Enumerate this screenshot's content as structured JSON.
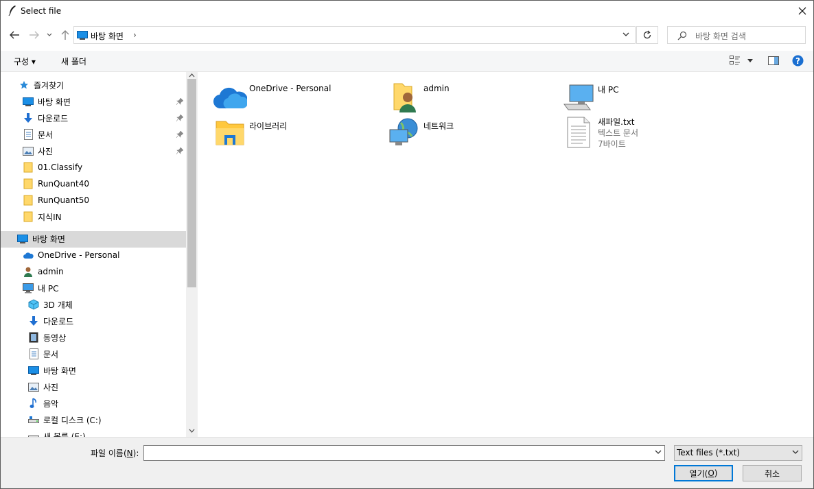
{
  "window": {
    "title": "Select file"
  },
  "address": {
    "path": "바탕 화면",
    "separator": "›"
  },
  "search": {
    "placeholder": "바탕 화면 검색"
  },
  "commandbar": {
    "organize": "구성 ▾",
    "new_folder": "새 폴더"
  },
  "nav": {
    "quick_access": "즐겨찾기",
    "qa_items": [
      "바탕 화면",
      "다운로드",
      "문서",
      "사진",
      "01.Classify",
      "RunQuant40",
      "RunQuant50",
      "지식IN"
    ],
    "desktop": "바탕 화면",
    "tree": [
      "OneDrive - Personal",
      "admin",
      "내 PC"
    ],
    "pc_items": [
      "3D 개체",
      "다운로드",
      "동영상",
      "문서",
      "바탕 화면",
      "사진",
      "음악",
      "로컬 디스크 (C:)",
      "새 볼륨 (E:)"
    ]
  },
  "content": {
    "items": [
      {
        "name": "OneDrive - Personal"
      },
      {
        "name": "admin"
      },
      {
        "name": "내 PC"
      },
      {
        "name": "라이브러리"
      },
      {
        "name": "네트워크"
      },
      {
        "name": "새파일.txt",
        "type": "텍스트 문서",
        "size": "7바이트"
      }
    ]
  },
  "footer": {
    "filename_label_prefix": "파일 이름(",
    "filename_label_key": "N",
    "filename_label_suffix": "):",
    "filename_value": "",
    "filetype": "Text files (*.txt)",
    "open_prefix": "열기(",
    "open_key": "O",
    "open_suffix": ")",
    "cancel": "취소"
  },
  "colors": {
    "accent": "#0078d7",
    "folder": "#ffd86b",
    "selection": "#d9d9d9"
  }
}
